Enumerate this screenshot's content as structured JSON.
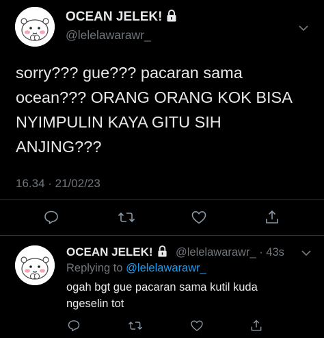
{
  "colors": {
    "background": "#000000",
    "text_primary": "#e7e9ea",
    "text_secondary": "#71767b",
    "link": "#1d9bf0",
    "divider": "#2f3336"
  },
  "main_tweet": {
    "display_name": "OCEAN JELEK!",
    "protected_icon": "lock-icon",
    "handle": "@lelelawarawr_",
    "text_lines": [
      "sorry??? gue??? pacaran sama",
      "ocean??? ORANG ORANG KOK BISA",
      "NYIMPULIN KAYA GITU SIH",
      "ANJING???"
    ],
    "timestamp": "16.34 · 21/02/23",
    "actions": [
      "reply-icon",
      "retweet-icon",
      "like-icon",
      "share-icon"
    ]
  },
  "reply_tweet": {
    "display_name": "OCEAN JELEK!",
    "protected_icon": "lock-icon",
    "handle_time": "@lelelawarawr_ · 43s",
    "replying_prefix": "Replying to",
    "replying_to": "@lelelawarawr_",
    "text_lines": [
      "ogah bgt gue pacaran sama kutil kuda",
      "ngeselin tot"
    ],
    "actions": [
      "reply-icon",
      "retweet-icon",
      "like-icon",
      "share-icon"
    ]
  }
}
